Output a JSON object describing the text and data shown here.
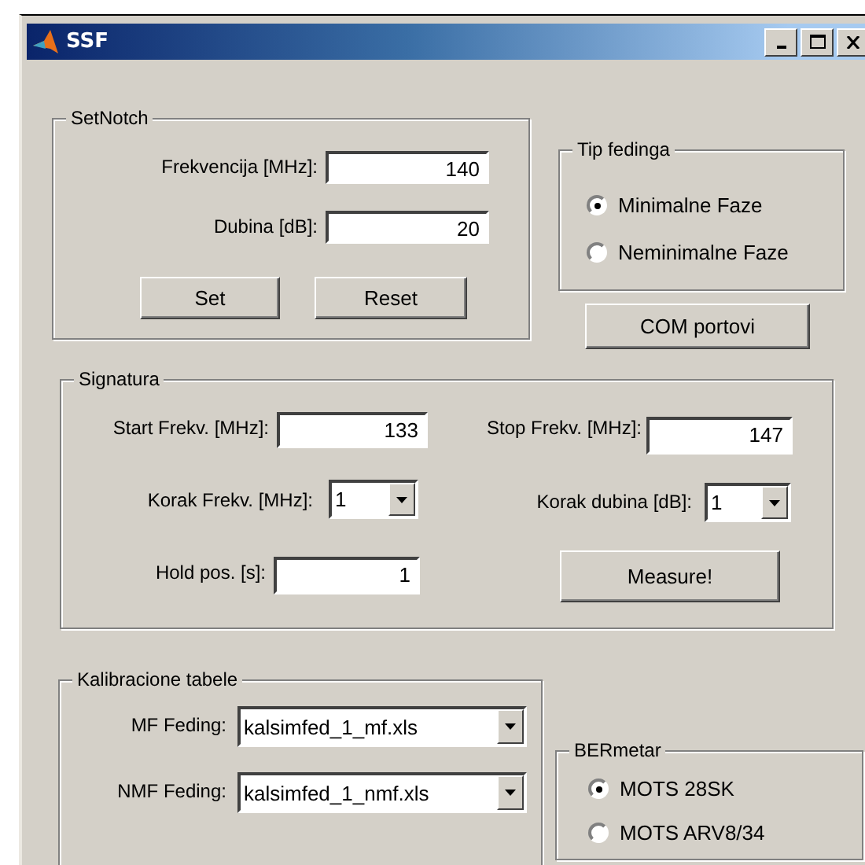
{
  "window": {
    "title": "SSF"
  },
  "set_notch": {
    "title": "SetNotch",
    "fields": [
      {
        "label": "Frekvencija [MHz]:",
        "value": "140"
      },
      {
        "label": "Dubina [dB]:",
        "value": "20"
      }
    ],
    "buttons": [
      "Set",
      "Reset"
    ]
  },
  "tip_fedinga": {
    "title": "Tip fedinga",
    "options": [
      {
        "label": "Minimalne Faze",
        "selected": true
      },
      {
        "label": "Neminimalne Faze",
        "selected": false
      }
    ]
  },
  "com_button": "COM portovi",
  "signatura": {
    "title": "Signatura",
    "start": {
      "label": "Start Frekv. [MHz]:",
      "value": "133"
    },
    "stop": {
      "label": "Stop Frekv. [MHz]:",
      "value": "147"
    },
    "korak_frekv": {
      "label": "Korak Frekv. [MHz]:",
      "value": "1"
    },
    "korak_dubina": {
      "label": "Korak dubina [dB]:",
      "value": "1"
    },
    "hold": {
      "label": "Hold pos. [s]:",
      "value": "1"
    },
    "measure_button": "Measure!"
  },
  "kalibracione": {
    "title": "Kalibracione tabele",
    "dropdowns": [
      {
        "label": "MF Feding:",
        "value": "kalsimfed_1_mf.xls"
      },
      {
        "label": "NMF Feding:",
        "value": "kalsimfed_1_nmf.xls"
      }
    ]
  },
  "bermetar": {
    "title": "BERmetar",
    "options": [
      {
        "label": "MOTS 28SK",
        "selected": true
      },
      {
        "label": "MOTS ARV8/34",
        "selected": false
      }
    ]
  }
}
